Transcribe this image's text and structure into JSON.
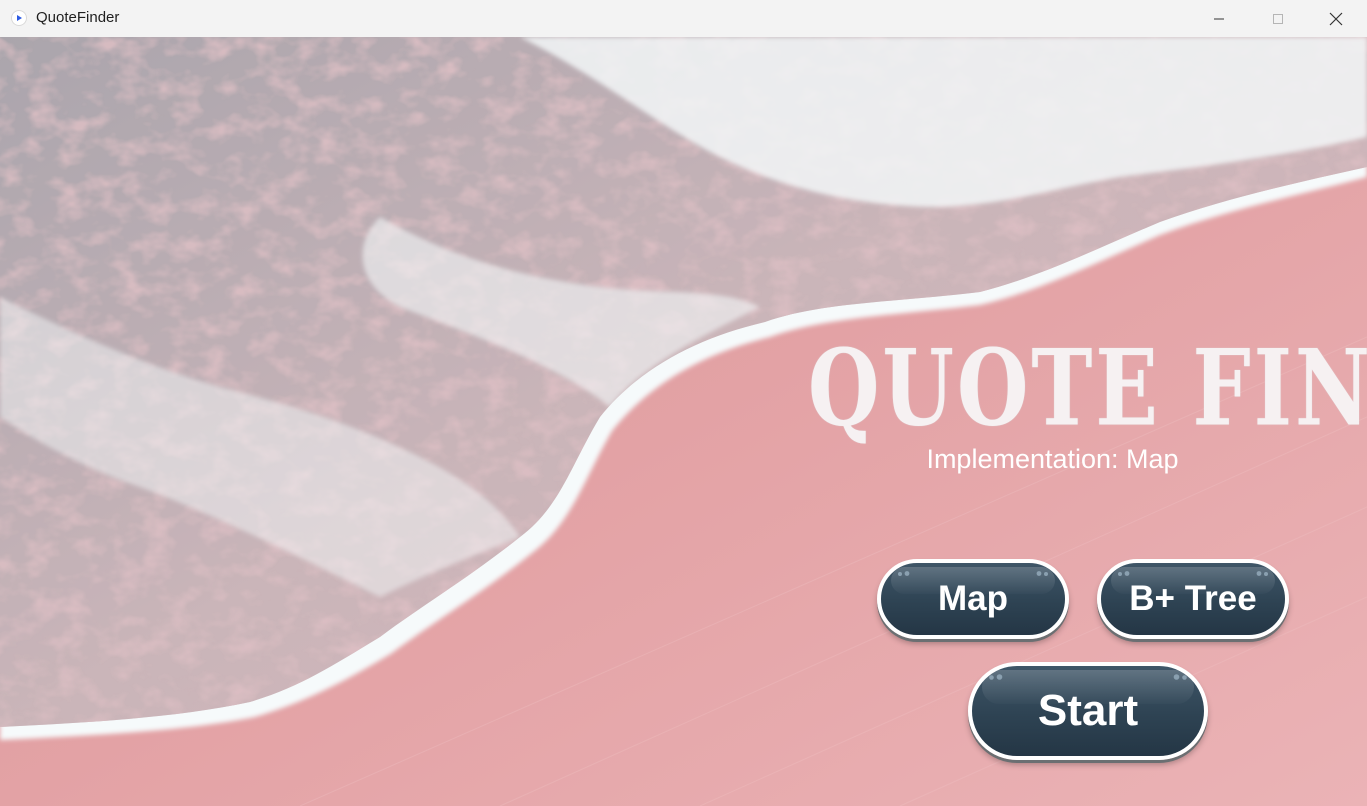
{
  "window": {
    "title": "QuoteFinder",
    "controls": {
      "minimize_icon": "minimize-icon",
      "maximize_icon": "maximize-icon",
      "close_icon": "close-icon"
    }
  },
  "hero": {
    "title": "QUOTE FINDER",
    "subtitle": "Implementation: Map"
  },
  "buttons": {
    "map": "Map",
    "bplus_tree": "B+ Tree",
    "start": "Start"
  },
  "colors": {
    "sand": "#e6a3a6",
    "foam": "#f7fbfc",
    "button_fill": "#2e4353",
    "button_border": "#ffffff"
  }
}
